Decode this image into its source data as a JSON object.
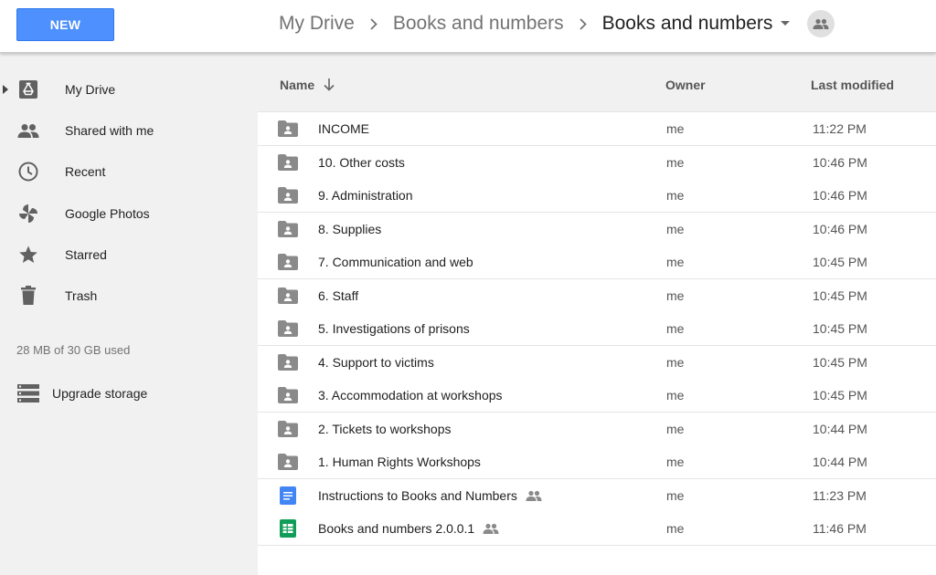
{
  "header": {
    "new_label": "NEW",
    "breadcrumb": [
      "My Drive",
      "Books and numbers",
      "Books and numbers"
    ]
  },
  "sidebar": {
    "items": [
      {
        "label": "My Drive",
        "icon": "drive-icon"
      },
      {
        "label": "Shared with me",
        "icon": "people-icon"
      },
      {
        "label": "Recent",
        "icon": "clock-icon"
      },
      {
        "label": "Google Photos",
        "icon": "pinwheel-icon"
      },
      {
        "label": "Starred",
        "icon": "star-icon"
      },
      {
        "label": "Trash",
        "icon": "trash-icon"
      }
    ],
    "storage": "28 MB of 30 GB used",
    "upgrade_label": "Upgrade storage"
  },
  "list": {
    "columns": {
      "name": "Name",
      "owner": "Owner",
      "modified": "Last modified"
    },
    "rows": [
      {
        "name": "INCOME",
        "owner": "me",
        "modified": "11:22 PM",
        "type": "shared-folder",
        "shared": false
      },
      {
        "name": "10. Other costs",
        "owner": "me",
        "modified": "10:46 PM",
        "type": "shared-folder",
        "shared": false
      },
      {
        "name": "9. Administration",
        "owner": "me",
        "modified": "10:46 PM",
        "type": "shared-folder",
        "shared": false
      },
      {
        "name": "8. Supplies",
        "owner": "me",
        "modified": "10:46 PM",
        "type": "shared-folder",
        "shared": false
      },
      {
        "name": "7. Communication and web",
        "owner": "me",
        "modified": "10:45 PM",
        "type": "shared-folder",
        "shared": false
      },
      {
        "name": "6. Staff",
        "owner": "me",
        "modified": "10:45 PM",
        "type": "shared-folder",
        "shared": false
      },
      {
        "name": "5. Investigations of prisons",
        "owner": "me",
        "modified": "10:45 PM",
        "type": "shared-folder",
        "shared": false
      },
      {
        "name": "4. Support to victims",
        "owner": "me",
        "modified": "10:45 PM",
        "type": "shared-folder",
        "shared": false
      },
      {
        "name": "3. Accommodation at workshops",
        "owner": "me",
        "modified": "10:45 PM",
        "type": "shared-folder",
        "shared": false
      },
      {
        "name": "2. Tickets to workshops",
        "owner": "me",
        "modified": "10:44 PM",
        "type": "shared-folder",
        "shared": false
      },
      {
        "name": "1. Human Rights Workshops",
        "owner": "me",
        "modified": "10:44 PM",
        "type": "shared-folder",
        "shared": false
      },
      {
        "name": "Instructions to Books and Numbers",
        "owner": "me",
        "modified": "11:23 PM",
        "type": "doc",
        "shared": true
      },
      {
        "name": "Books and numbers 2.0.0.1",
        "owner": "me",
        "modified": "11:46 PM",
        "type": "sheet",
        "shared": true
      }
    ]
  },
  "colors": {
    "new_button": "#4d90fe",
    "folder_icon": "#8a8a8a",
    "doc_icon": "#4285f4",
    "sheet_icon": "#0f9d58"
  }
}
